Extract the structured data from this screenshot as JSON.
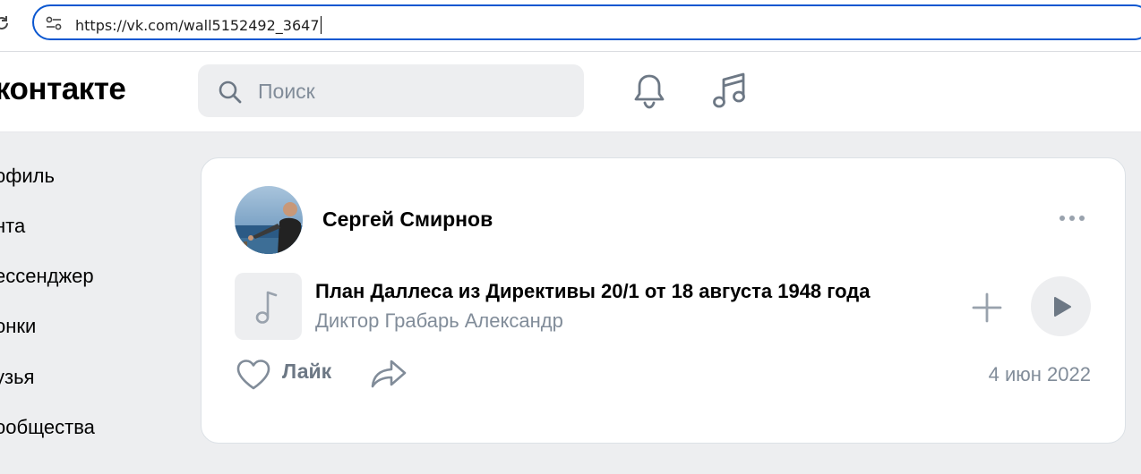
{
  "browser": {
    "url": "https://vk.com/wall5152492_3647"
  },
  "header": {
    "logo_text": "контакте",
    "search_placeholder": "Поиск"
  },
  "nav": {
    "items": [
      {
        "label": "офиль"
      },
      {
        "label": "нта"
      },
      {
        "label": "ессенджер"
      },
      {
        "label": "онки"
      },
      {
        "label": "узья"
      },
      {
        "label": "ообщества"
      }
    ]
  },
  "post": {
    "author": "Сергей Смирнов",
    "date": "4 июн 2022",
    "audio": {
      "title": "План Даллеса из Директивы 20/1 от 18 августа 1948 года",
      "artist": "Диктор Грабарь Александр"
    },
    "like_label": "Лайк"
  },
  "colors": {
    "accent": "#0b57d0",
    "page_bg": "#edeef0",
    "secondary_text": "#818c99",
    "icon_color": "#6d7885"
  },
  "icons": [
    "reload-icon",
    "site-info-icon",
    "search-icon",
    "bell-icon",
    "music-note-icon",
    "more-icon",
    "add-icon",
    "play-icon",
    "heart-icon",
    "share-icon"
  ]
}
